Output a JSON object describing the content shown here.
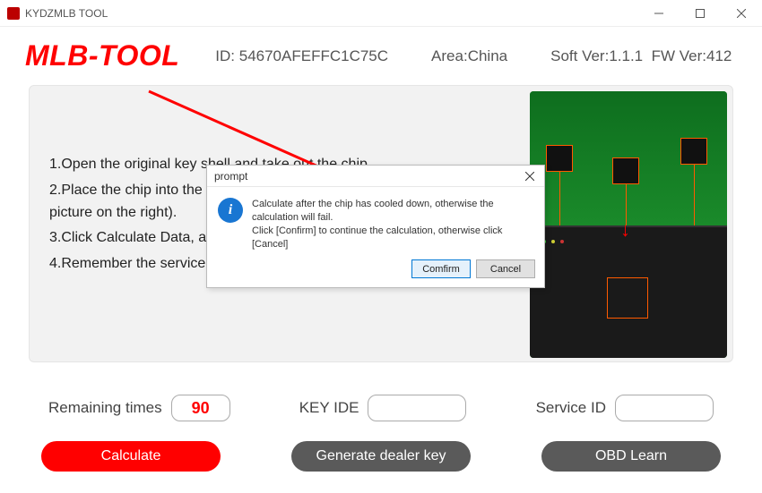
{
  "window": {
    "title": "KYDZMLB TOOL"
  },
  "header": {
    "brand": "MLB-TOOL",
    "id_label": "ID:",
    "id_value": "54670AFEFFC1C75C",
    "area_label": "Area:",
    "area_value": "China",
    "soft_label": "Soft Ver:",
    "soft_value": "1.1.1",
    "fw_label": "FW Ver:",
    "fw_value": "412"
  },
  "instructions": {
    "step1": "1.Open the original key shell and take out the chip.",
    "step2": "2.Place the chip into the adapter according to the direction (as shown in the picture on the right).",
    "step3": "3.Click Calculate Data, and wait for a few minutes to get the key data.",
    "step4": "4.Remember the service ID for third-party device learning keys."
  },
  "dialog": {
    "title": "prompt",
    "message_line1": "Calculate after the chip has cooled down, otherwise the calculation will fail.",
    "message_line2": "Click [Confirm] to continue the calculation, otherwise click [Cancel]",
    "confirm_label": "Comfirm",
    "cancel_label": "Cancel"
  },
  "fields": {
    "remaining_label": "Remaining times",
    "remaining_value": "90",
    "keyide_label": "KEY IDE",
    "keyide_value": "",
    "service_label": "Service ID",
    "service_value": ""
  },
  "buttons": {
    "calculate": "Calculate",
    "generate": "Generate dealer key",
    "obd": "OBD Learn"
  }
}
